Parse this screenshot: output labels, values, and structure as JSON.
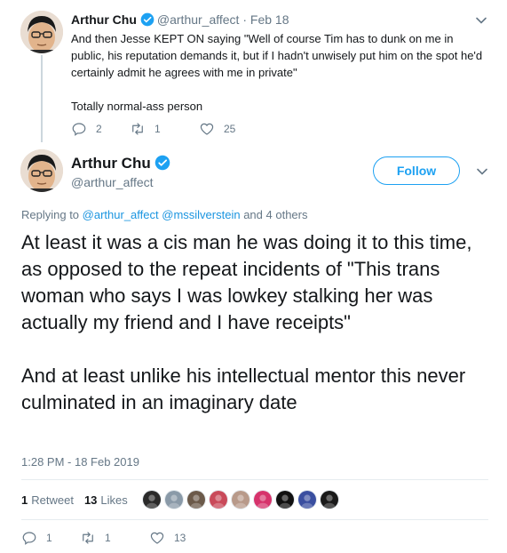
{
  "reply_tweet": {
    "name": "Arthur Chu",
    "handle": "@arthur_affect",
    "separator": "·",
    "date": "Feb 18",
    "text": "And then Jesse KEPT ON saying \"Well of course Tim has to dunk on me in public, his reputation demands it, but if I hadn't unwisely put him on the spot he'd certainly admit he agrees with me in private\"\n\nTotally normal-ass person",
    "replies": "2",
    "retweets": "1",
    "likes": "25"
  },
  "main_tweet": {
    "name": "Arthur Chu",
    "handle": "@arthur_affect",
    "follow_label": "Follow",
    "replying_prefix": "Replying to",
    "replying_user1": "@arthur_affect",
    "replying_user2": "@mssilverstein",
    "replying_suffix": "and 4 others",
    "text": "At least it was a cis man he was doing it to this time, as opposed to the repeat incidents of \"This trans woman who says I was lowkey stalking her was actually my friend and I have receipts\"\n\nAnd at least unlike his intellectual mentor this never culminated in an imaginary date",
    "timestamp": "1:28 PM - 18 Feb 2019",
    "retweet_count": "1",
    "retweet_label": "Retweet",
    "like_count": "13",
    "like_label": "Likes",
    "replies": "1",
    "retweets": "1",
    "likes": "13"
  },
  "colors": {
    "accent": "#1da1f2",
    "link": "#1b95e0",
    "muted": "#657786",
    "text": "#14171a"
  },
  "icons": {
    "verified": "verified-badge-icon",
    "caret": "chevron-down-icon",
    "reply": "reply-icon",
    "retweet": "retweet-icon",
    "like": "heart-icon"
  },
  "liker_colors": [
    "#2a2a2a",
    "#8a9aa8",
    "#6b5a4a",
    "#c94a5a",
    "#b89a8a",
    "#d6336c",
    "#111111",
    "#3a4fa0",
    "#1a1a1a"
  ]
}
